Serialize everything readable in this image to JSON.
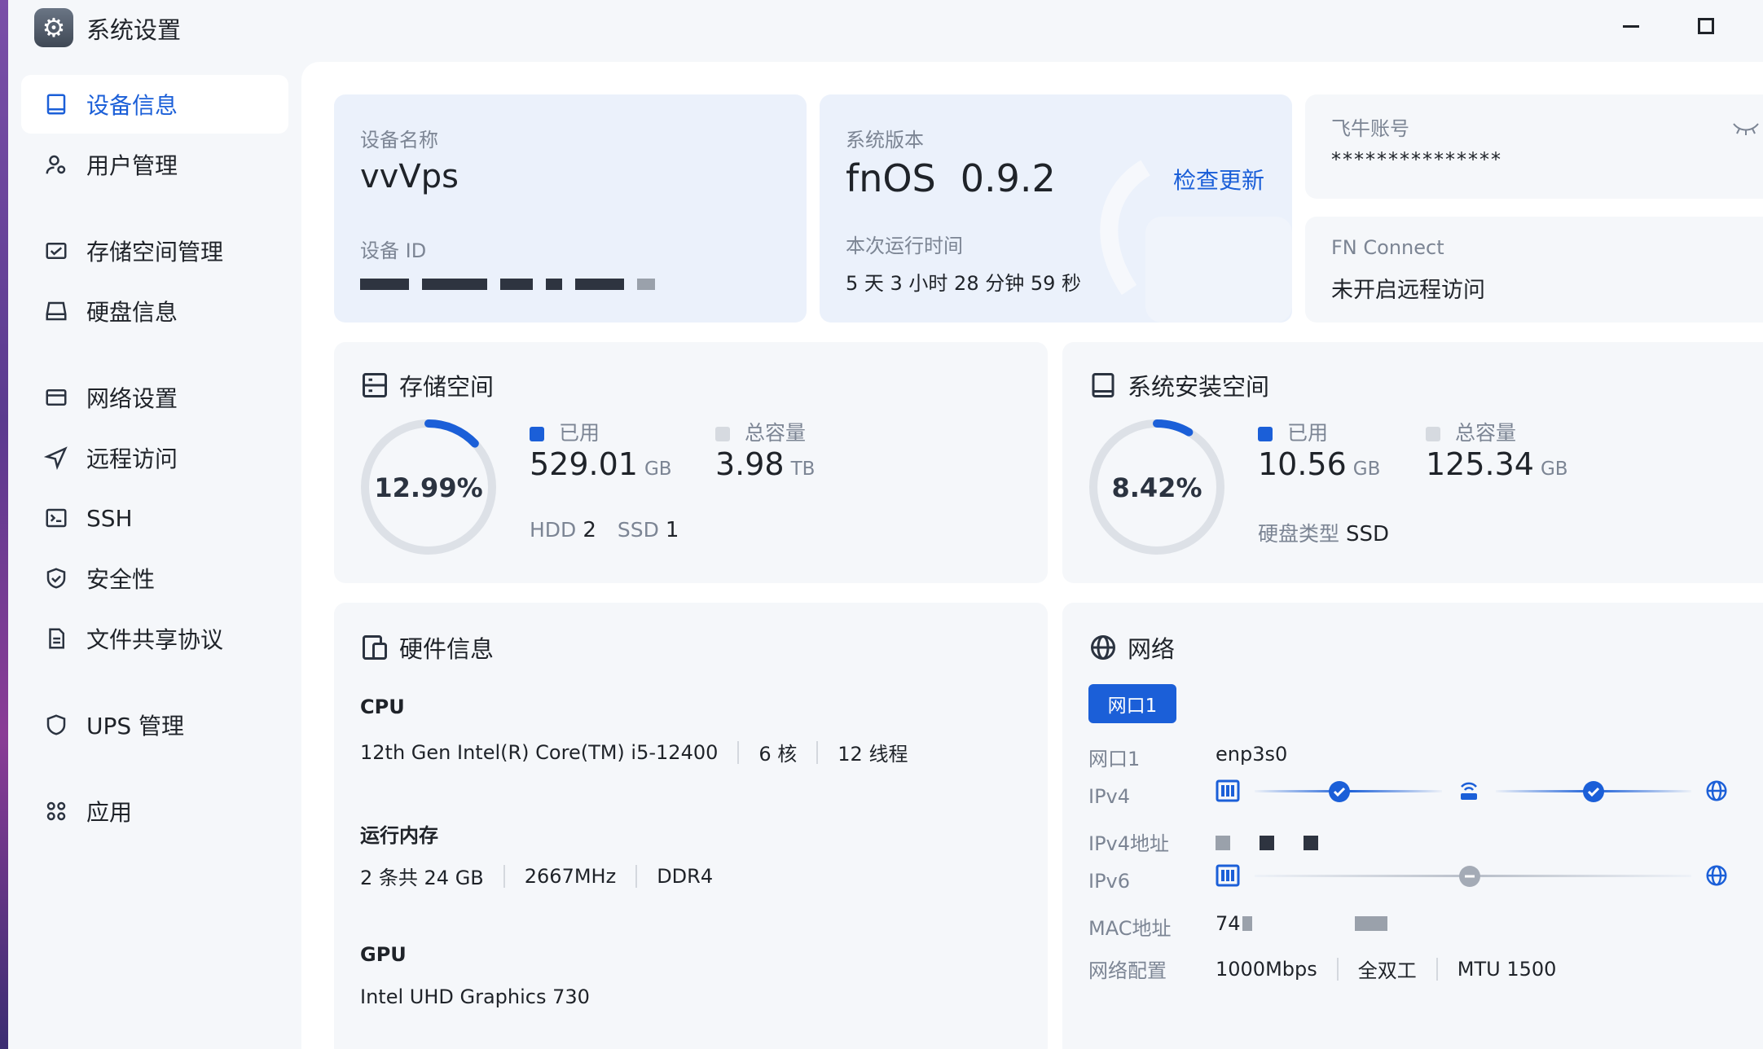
{
  "window": {
    "title": "系统设置",
    "icon": "gear-icon"
  },
  "sidebar": {
    "items": [
      {
        "label": "设备信息",
        "icon": "device-icon",
        "active": true
      },
      {
        "label": "用户管理",
        "icon": "user-icon"
      },
      {
        "label": "存储空间管理",
        "icon": "storage-icon"
      },
      {
        "label": "硬盘信息",
        "icon": "disk-icon"
      },
      {
        "label": "网络设置",
        "icon": "network-icon"
      },
      {
        "label": "远程访问",
        "icon": "send-icon"
      },
      {
        "label": "SSH",
        "icon": "terminal-icon"
      },
      {
        "label": "安全性",
        "icon": "shield-check-icon"
      },
      {
        "label": "文件共享协议",
        "icon": "file-icon"
      },
      {
        "label": "UPS 管理",
        "icon": "shield-icon"
      },
      {
        "label": "应用",
        "icon": "apps-icon"
      }
    ]
  },
  "device": {
    "name_label": "设备名称",
    "name": "vvVps",
    "id_label": "设备 ID"
  },
  "system": {
    "version_label": "系统版本",
    "os": "fnOS",
    "version": "0.9.2",
    "check_update": "检查更新",
    "uptime_label": "本次运行时间",
    "uptime": "5 天 3 小时 28 分钟 59 秒"
  },
  "account": {
    "label": "飞牛账号",
    "masked": "***************",
    "icon": "eye-closed-icon"
  },
  "fn_connect": {
    "label": "FN Connect",
    "status": "未开启远程访问"
  },
  "storage": {
    "title": "存储空间",
    "percent": "12.99%",
    "percent_value": 12.99,
    "used_label": "已用",
    "used": "529.01",
    "used_unit": "GB",
    "total_label": "总容量",
    "total": "3.98",
    "total_unit": "TB",
    "hdd_label": "HDD",
    "hdd": "2",
    "ssd_label": "SSD",
    "ssd": "1"
  },
  "sys_space": {
    "title": "系统安装空间",
    "percent": "8.42%",
    "percent_value": 8.42,
    "used_label": "已用",
    "used": "10.56",
    "used_unit": "GB",
    "total_label": "总容量",
    "total": "125.34",
    "total_unit": "GB",
    "disk_type_label": "硬盘类型",
    "disk_type": "SSD"
  },
  "hardware": {
    "title": "硬件信息",
    "cpu_label": "CPU",
    "cpu_model": "12th Gen Intel(R) Core(TM) i5-12400",
    "cpu_cores": "6 核",
    "cpu_threads": "12 线程",
    "ram_label": "运行内存",
    "ram_size": "2 条共 24 GB",
    "ram_freq": "2667MHz",
    "ram_type": "DDR4",
    "gpu_label": "GPU",
    "gpu_model": "Intel UHD Graphics 730"
  },
  "network": {
    "title": "网络",
    "tab": "网口1",
    "port_label": "网口1",
    "port_value": "enp3s0",
    "ipv4_label": "IPv4",
    "ipv4_addr_label": "IPv4地址",
    "ipv6_label": "IPv6",
    "mac_label": "MAC地址",
    "mac_prefix": "74",
    "config_label": "网络配置",
    "speed": "1000Mbps",
    "duplex": "全双工",
    "mtu": "MTU 1500"
  },
  "colors": {
    "accent": "#1b5fd8",
    "ring_track": "#dde1e7",
    "legend_total": "#d6dae0"
  }
}
